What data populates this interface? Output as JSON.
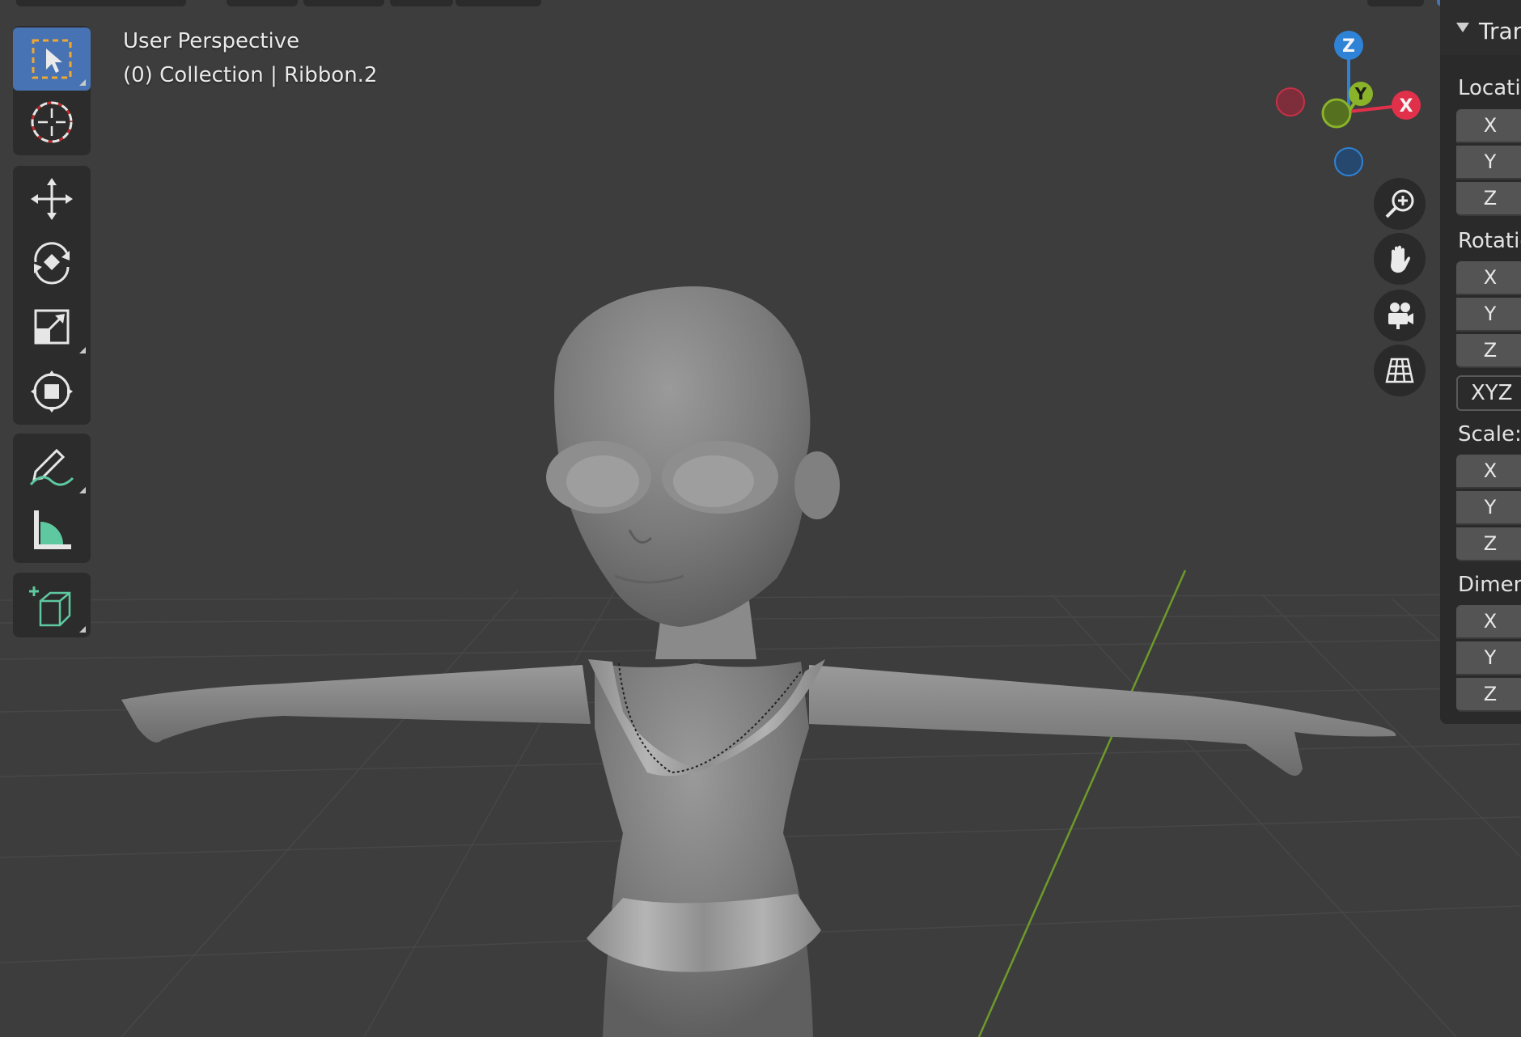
{
  "viewport": {
    "title": "User Perspective",
    "subtitle": "(0) Collection | Ribbon.2"
  },
  "toolbar": {
    "tools": [
      {
        "name": "select-box",
        "active": true
      },
      {
        "name": "cursor",
        "active": false
      },
      {
        "name": "move",
        "active": false
      },
      {
        "name": "rotate",
        "active": false
      },
      {
        "name": "scale",
        "active": false
      },
      {
        "name": "transform",
        "active": false
      },
      {
        "name": "annotate",
        "active": false
      },
      {
        "name": "measure",
        "active": false
      },
      {
        "name": "add-cube",
        "active": false
      }
    ]
  },
  "gizmo": {
    "x_label": "X",
    "y_label": "Y",
    "z_label": "Z",
    "colors": {
      "x": "#e0304a",
      "y": "#8ab32a",
      "z": "#2f83d6"
    }
  },
  "nav_buttons": [
    "zoom-icon",
    "hand-pan-icon",
    "camera-icon",
    "grid-ortho-icon"
  ],
  "properties": {
    "panel_title": "Tran",
    "location_label": "Locatio",
    "rotation_label": "Rotatio",
    "rotation_mode": "XYZ E",
    "scale_label": "Scale:",
    "dimensions_label": "Dimen",
    "axis": {
      "x": "X",
      "y": "Y",
      "z": "Z"
    }
  },
  "colors": {
    "viewport_bg": "#3d3d3d",
    "active_tool": "#4772b3",
    "panel_bg": "#2a2a2a",
    "grid_y_axis": "#6e9a2a"
  }
}
